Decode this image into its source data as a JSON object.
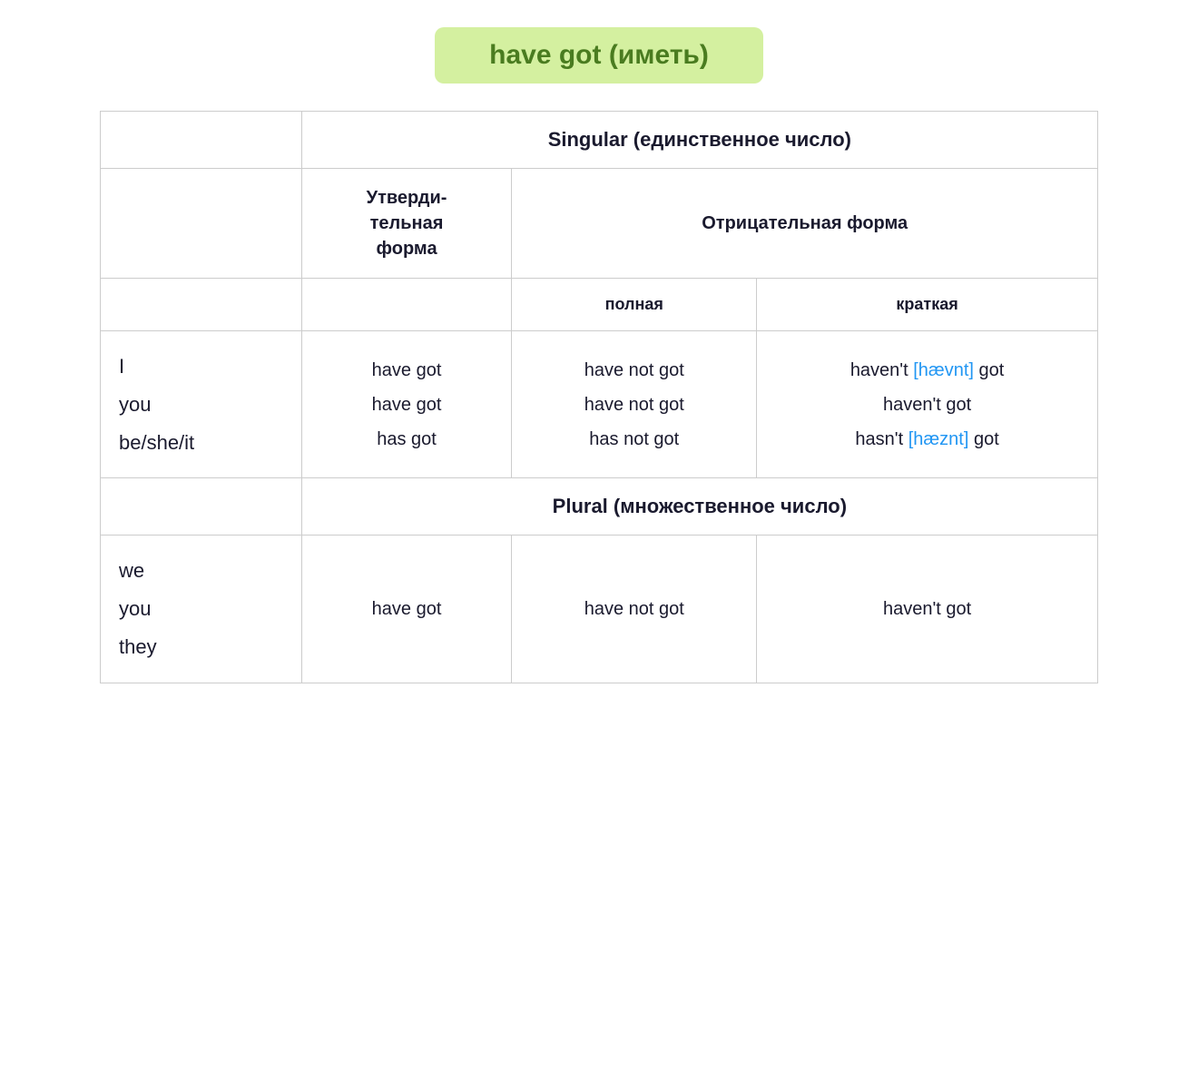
{
  "title": "have got (иметь)",
  "singular_label": "Singular (единственное число)",
  "plural_label": "Plural (множественное число)",
  "header": {
    "affirmative": "Утверди-\nтельная\nформа",
    "negative_title": "Отрицательная форма",
    "negative_full": "полная",
    "negative_short": "краткая"
  },
  "singular_rows": [
    {
      "pronoun": "I",
      "affirmative": "have got",
      "negative_full": "have not got",
      "negative_short_before": "haven't",
      "phonetic": "[hævnt]",
      "negative_short_after": "got"
    },
    {
      "pronoun": "you",
      "affirmative": "have got",
      "negative_full": "have not got",
      "negative_short_before": "haven't",
      "phonetic": "",
      "negative_short_after": "got"
    },
    {
      "pronoun": "be/she/it",
      "affirmative": "has got",
      "negative_full": "has not got",
      "negative_short_before": "hasn't",
      "phonetic": "[hæznt]",
      "negative_short_after": "got"
    }
  ],
  "plural_row": {
    "pronouns": [
      "we",
      "you",
      "they"
    ],
    "affirmative": "have got",
    "negative_full": "have not got",
    "negative_short": "haven't got"
  }
}
